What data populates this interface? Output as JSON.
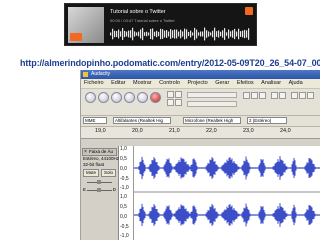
{
  "player": {
    "title": "Tutorial sobre o Twitter",
    "subtitle": "00:00 / 03:47  Tutorial sobre o Twitter"
  },
  "url": "http://almerindopinho.podomatic.com/entry/2012-05-09T20_26_54-07_00",
  "app": {
    "window_title": "Audacity",
    "menus": [
      "Ficheiro",
      "Editar",
      "Mostrar",
      "Controlo",
      "Projecto",
      "Gerar",
      "Efeitos",
      "Analisar",
      "Ajuda"
    ],
    "host": "MME",
    "output_device": "Altifalantes (Realtek Hig",
    "input_device": "Microfone (Realtek High",
    "input_channels": "2 (Estéreo)",
    "ruler_ticks": [
      "19,0",
      "20,0",
      "21,0",
      "22,0",
      "23,0",
      "24,0"
    ],
    "track": {
      "name": "Faixa de Áu",
      "info1": "Estéreo, 44100Hz",
      "info2": "32-bit float",
      "mute": "Mute",
      "solo": "Solo",
      "pan_left": "E",
      "pan_right": "D"
    },
    "scale_labels": [
      "1,0",
      "0,5",
      "0,0",
      "-0,5",
      "-1,0",
      "1,0",
      "0,5",
      "0,0",
      "-0,5",
      "-1,0"
    ],
    "waveform_color": "#3b4ec8"
  }
}
